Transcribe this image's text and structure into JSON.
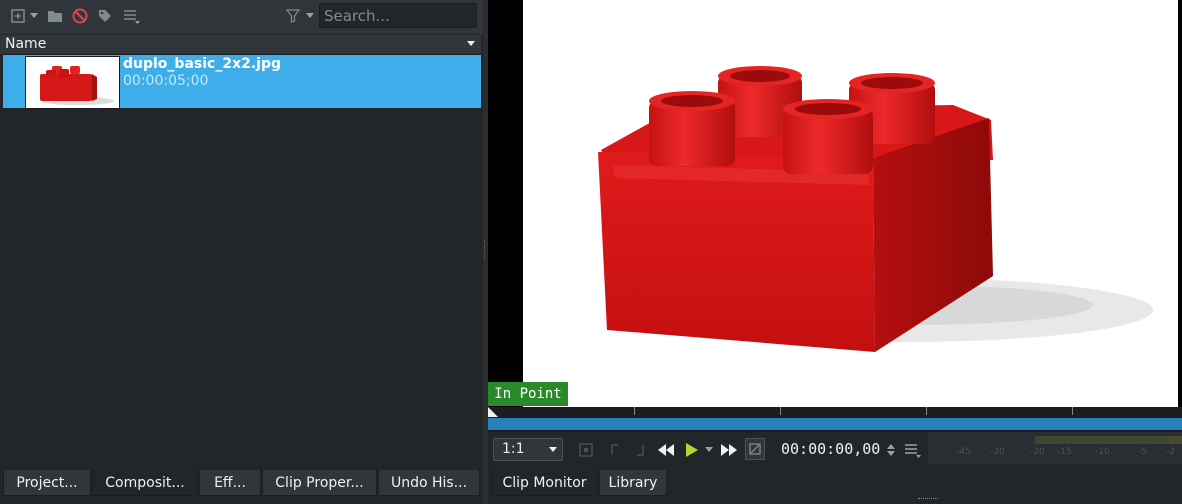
{
  "bin": {
    "search": {
      "placeholder": "Search..."
    },
    "column_header": "Name",
    "clip": {
      "name": "duplo_basic_2x2.jpg",
      "duration": "00:00:05;00"
    }
  },
  "left_tabs": [
    "Project...",
    "Composit...",
    "Eff...",
    "Clip Proper...",
    "Undo His..."
  ],
  "monitor": {
    "in_point_label": "In Point",
    "zoom_value": "1:1",
    "timecode": "00:00:00,00",
    "meter_labels": [
      "-45",
      "-30",
      "-20",
      "-15",
      "-10",
      "-5",
      "-2"
    ]
  },
  "right_tabs": [
    "Clip Monitor",
    "Library"
  ],
  "colors": {
    "selection": "#3daee9",
    "in_point_badge": "#2a8a29",
    "ruler_bar": "#2980b9",
    "play_icon": "#b4d430"
  }
}
